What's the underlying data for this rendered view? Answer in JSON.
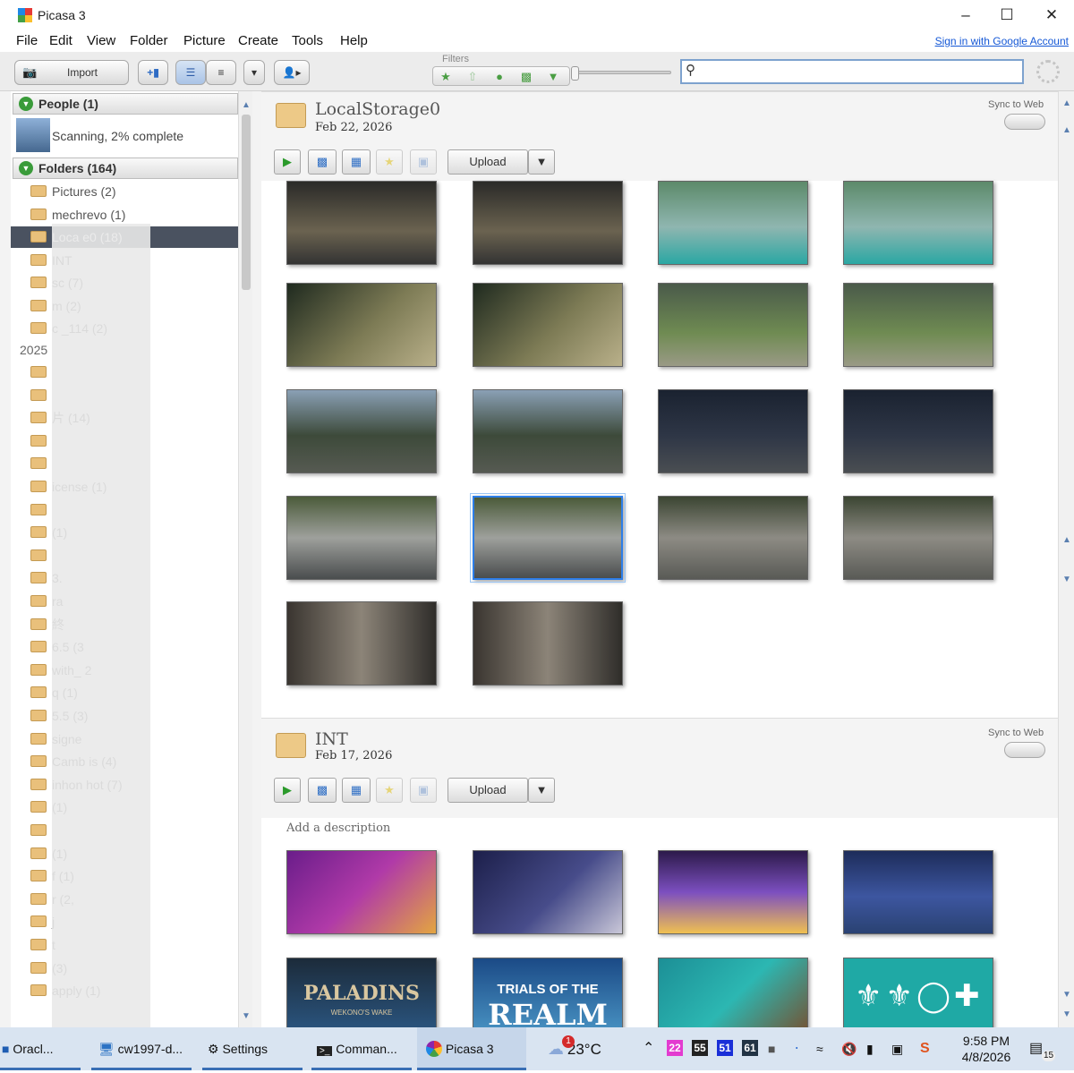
{
  "window": {
    "title": "Picasa 3"
  },
  "menu": [
    "File",
    "Edit",
    "View",
    "Folder",
    "Picture",
    "Create",
    "Tools",
    "Help"
  ],
  "sign_in": "Sign in with Google Account",
  "toolbar": {
    "import_label": "Import",
    "filters_label": "Filters"
  },
  "left": {
    "people_header": "People (1)",
    "scanning": "Scanning, 2% complete",
    "folders_header": "Folders (164)",
    "folders": [
      "Pictures (2)",
      "mechrevo (1)",
      "Loca e0 (18)",
      "INT",
      "sc (7)",
      "m (2)",
      "c _114 (2)"
    ],
    "year": "2025",
    "folders_2025": [
      "",
      "",
      "片 (14)",
      "",
      "",
      "icense (1)",
      "",
      "(1)",
      "",
      "3.",
      "ra",
      "終",
      "6.5 (3",
      "with_ 2",
      "q (1)",
      "5.5 (3)",
      "signe",
      "Camb is (4)",
      "inhon hot (7)",
      "(1)",
      "",
      "(1)",
      "f (1)",
      "r (2,",
      "j",
      "t",
      "(3)",
      "apply (1)"
    ]
  },
  "groups": [
    {
      "name": "LocalStorage0",
      "date": "Feb 22, 2026",
      "sync_label": "Sync to Web",
      "upload_label": "Upload",
      "description": ""
    },
    {
      "name": "INT",
      "date": "Feb 17, 2026",
      "sync_label": "Sync to Web",
      "upload_label": "Upload",
      "description": "Add a description"
    }
  ],
  "thumb_text": {
    "paladins": "PALADINS",
    "paladins_sub": "WEKONO'S WAKE",
    "trials": "TRIALS OF THE",
    "realm": "REALM"
  },
  "taskbar": {
    "items": [
      "Oracl...",
      "cw1997-d...",
      "Settings",
      "Comman...",
      "Picasa 3"
    ],
    "weather_temp": "23°C",
    "weather_badge": "1",
    "tray_nums": [
      "22",
      "55",
      "51",
      "61"
    ],
    "time": "9:58 PM",
    "date": "4/8/2026",
    "notif": "15"
  },
  "colors": {
    "accent": "#2d7ee8",
    "selected_row": "#4a5260",
    "green": "#3a9b3a"
  }
}
